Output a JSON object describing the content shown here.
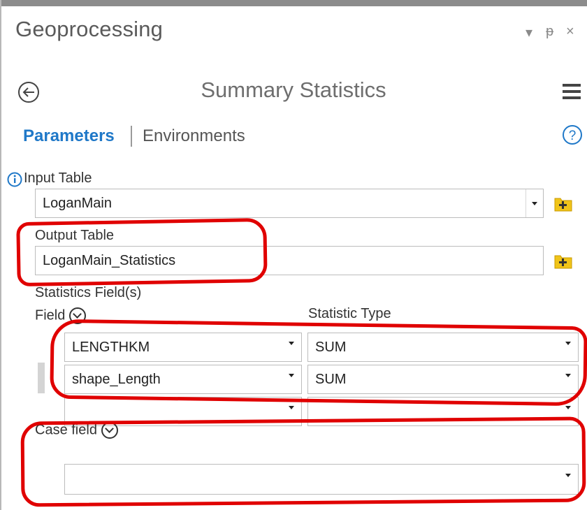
{
  "pane": {
    "title": "Geoprocessing",
    "controls": [
      "▾",
      "ᵽ",
      "×"
    ]
  },
  "tool": {
    "title": "Summary Statistics"
  },
  "tabs": {
    "parameters": "Parameters",
    "environments": "Environments"
  },
  "input_table": {
    "label": "Input Table",
    "value": "LoganMain"
  },
  "output_table": {
    "label": "Output Table",
    "value": "LoganMain_Statistics"
  },
  "statistics": {
    "label": "Statistics Field(s)",
    "field_header": "Field",
    "type_header": "Statistic Type",
    "rows": [
      {
        "field": "LENGTHKM",
        "type": "SUM"
      },
      {
        "field": "shape_Length",
        "type": "SUM"
      },
      {
        "field": "",
        "type": ""
      }
    ]
  },
  "case_field": {
    "label": "Case field",
    "value": ""
  },
  "colors": {
    "accent": "#1f78c8",
    "annotation_red": "#e00000",
    "folder_yellow": "#f0c419"
  }
}
